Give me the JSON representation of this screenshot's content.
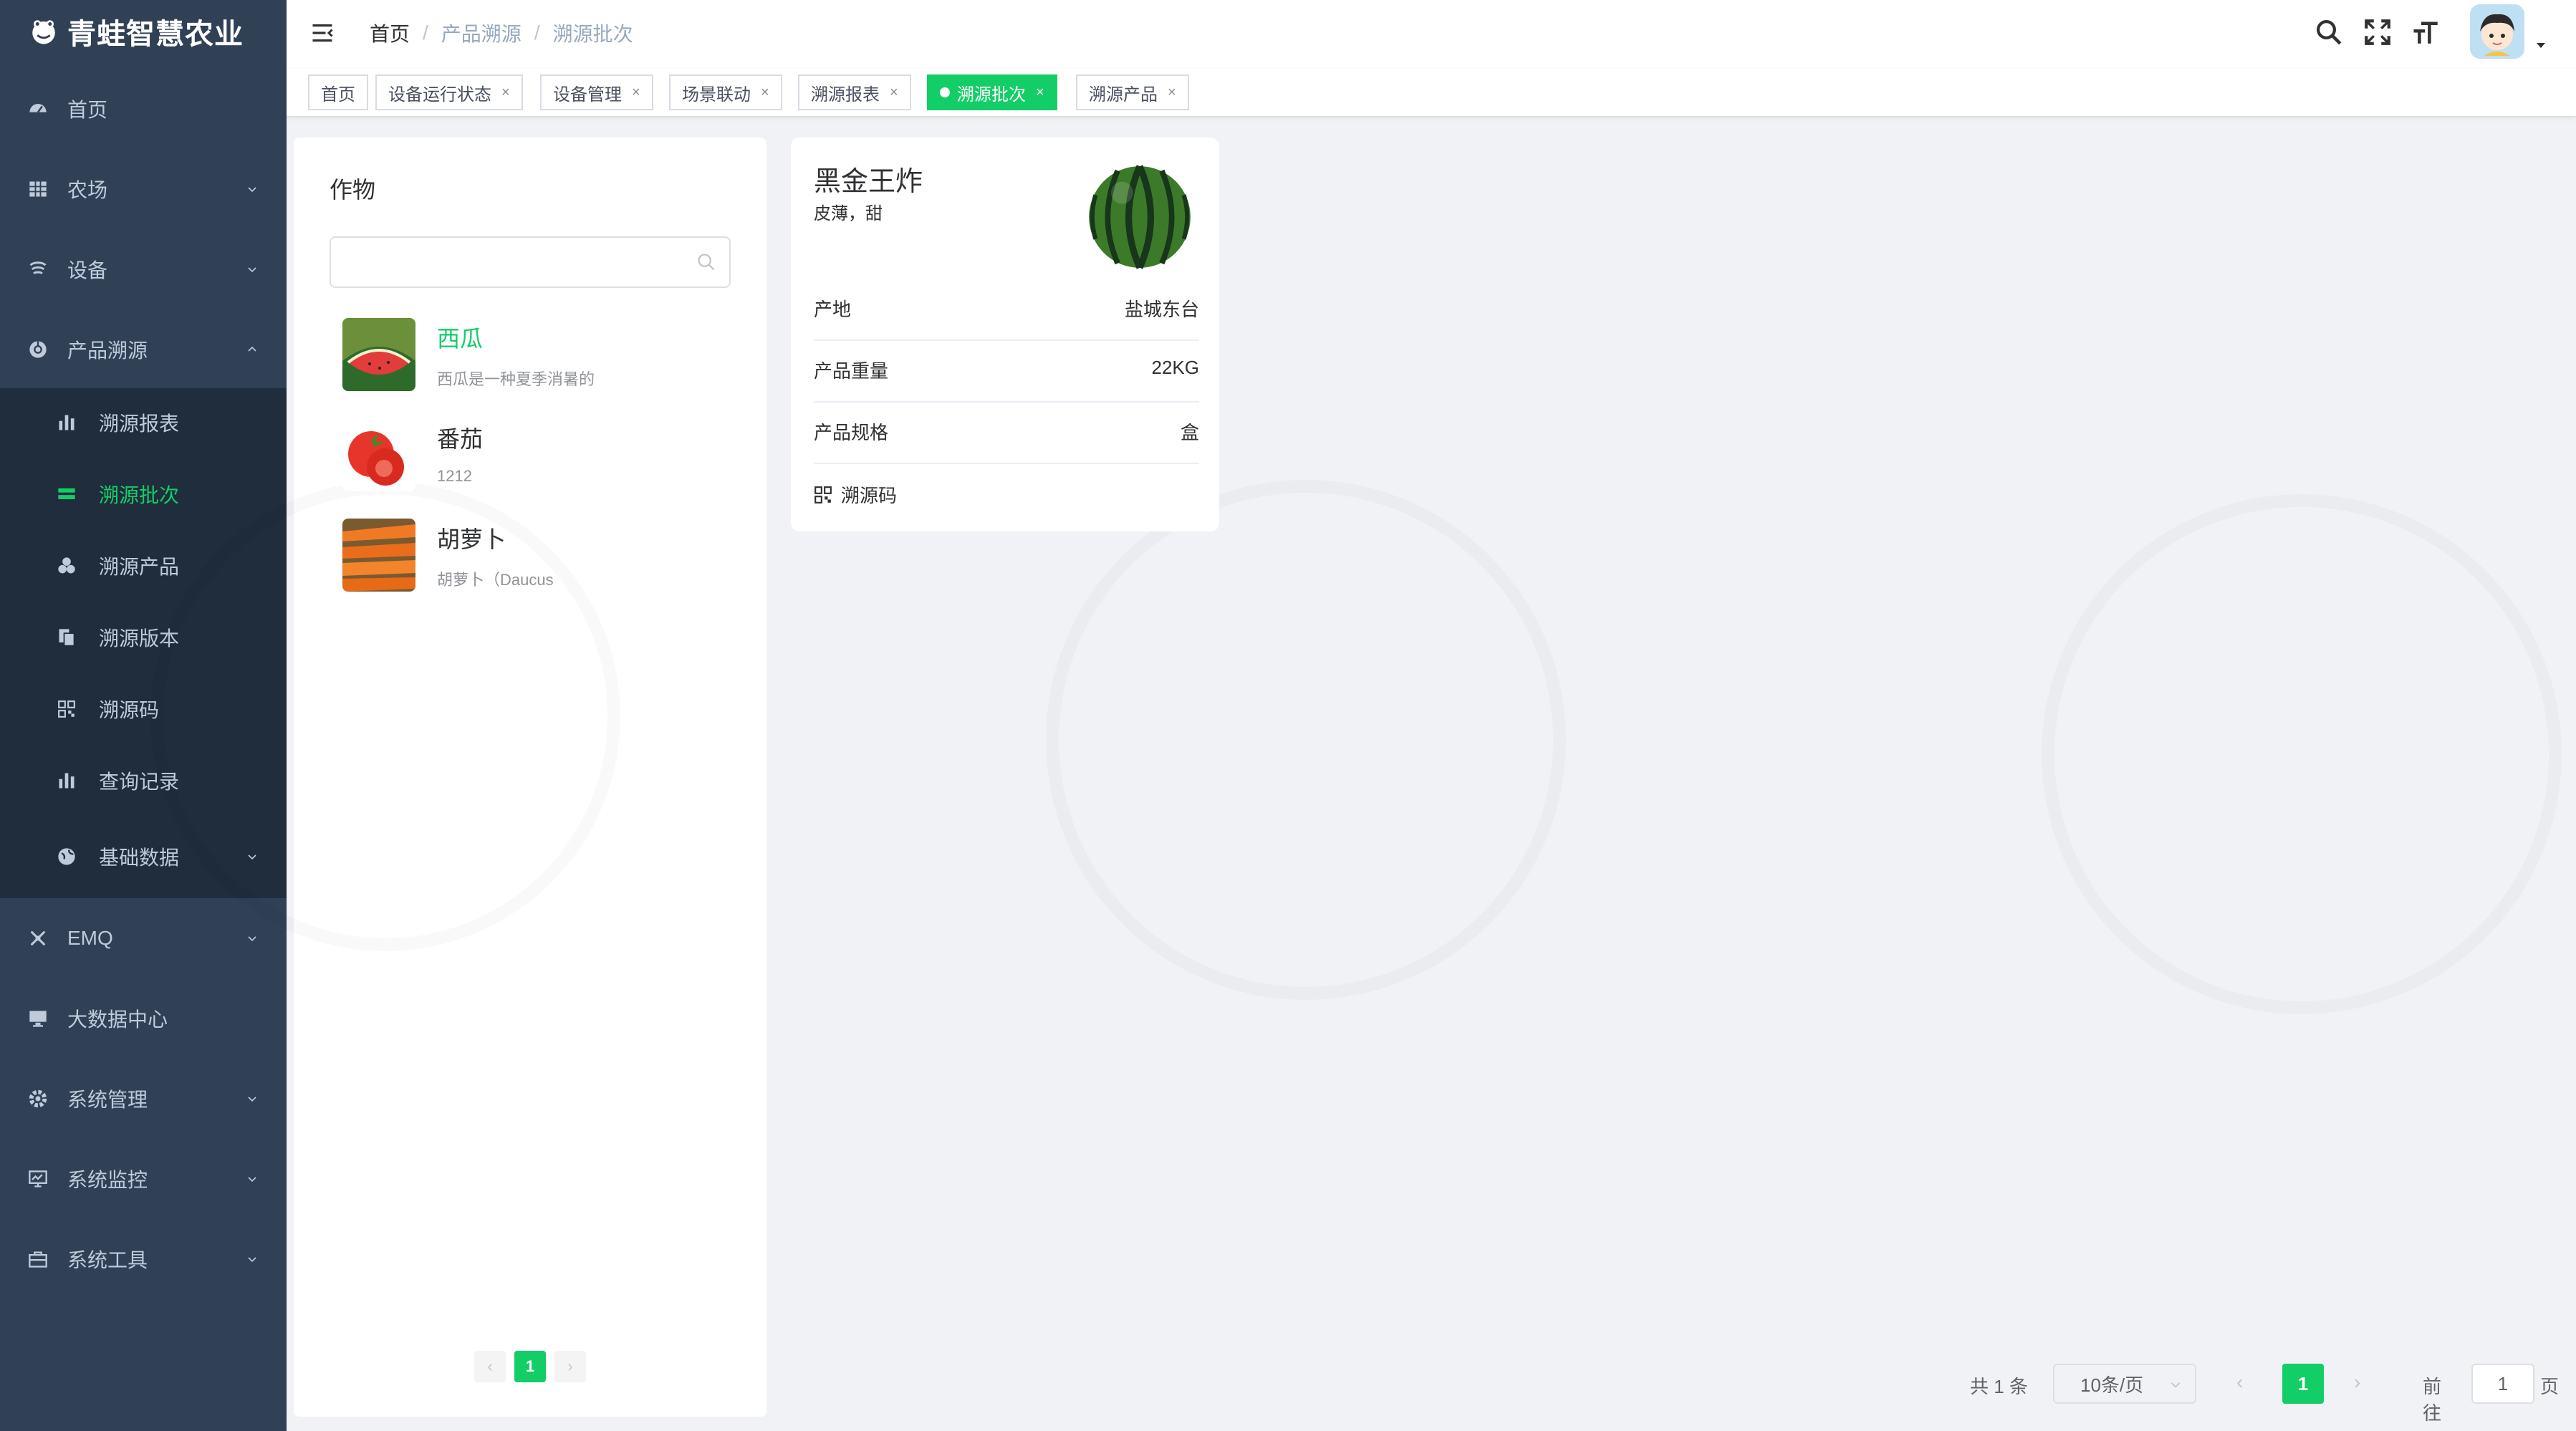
{
  "app": {
    "title": "青蛙智慧农业"
  },
  "sidebar": {
    "items": [
      {
        "label": "首页",
        "icon": "dashboard-icon"
      },
      {
        "label": "农场",
        "icon": "grid-icon",
        "expandable": true
      },
      {
        "label": "设备",
        "icon": "device-icon",
        "expandable": true
      },
      {
        "label": "产品溯源",
        "icon": "trace-icon",
        "expandable": true,
        "expanded": true
      },
      {
        "label": "EMQ",
        "icon": "emq-icon",
        "expandable": true
      },
      {
        "label": "大数据中心",
        "icon": "monitor-icon"
      },
      {
        "label": "系统管理",
        "icon": "gear-icon",
        "expandable": true
      },
      {
        "label": "系统监控",
        "icon": "monitor-chart-icon",
        "expandable": true
      },
      {
        "label": "系统工具",
        "icon": "toolbox-icon",
        "expandable": true
      }
    ],
    "subitems": [
      {
        "label": "溯源报表",
        "icon": "bar-chart-icon"
      },
      {
        "label": "溯源批次",
        "icon": "list-icon",
        "active": true
      },
      {
        "label": "溯源产品",
        "icon": "product-icon"
      },
      {
        "label": "溯源版本",
        "icon": "copy-icon"
      },
      {
        "label": "溯源码",
        "icon": "qrcode-icon"
      },
      {
        "label": "查询记录",
        "icon": "bar-chart-icon"
      },
      {
        "label": "基础数据",
        "icon": "globe-icon",
        "expandable": true
      }
    ]
  },
  "header": {
    "breadcrumb": [
      "首页",
      "产品溯源",
      "溯源批次"
    ]
  },
  "tags": [
    {
      "label": "首页",
      "closable": false
    },
    {
      "label": "设备运行状态",
      "closable": true
    },
    {
      "label": "设备管理",
      "closable": true
    },
    {
      "label": "场景联动",
      "closable": true
    },
    {
      "label": "溯源报表",
      "closable": true
    },
    {
      "label": "溯源批次",
      "closable": true,
      "active": true
    },
    {
      "label": "溯源产品",
      "closable": true
    }
  ],
  "close_glyph": "×",
  "crops": {
    "title": "作物",
    "search_placeholder": "",
    "items": [
      {
        "name": "西瓜",
        "desc": "西瓜是一种夏季消暑的",
        "active": true
      },
      {
        "name": "番茄",
        "desc": "1212"
      },
      {
        "name": "胡萝卜",
        "desc": "胡萝卜（Daucus"
      }
    ],
    "pager": {
      "prev": "‹",
      "current": "1",
      "next": "›"
    }
  },
  "detail": {
    "name": "黑金王炸",
    "subtitle": "皮薄，甜",
    "rows": [
      {
        "label": "产地",
        "value": "盐城东台"
      },
      {
        "label": "产品重量",
        "value": "22KG"
      },
      {
        "label": "产品规格",
        "value": "盒"
      }
    ],
    "trace_code_label": "溯源码"
  },
  "pagination": {
    "total": "共 1 条",
    "page_size": "10条/页",
    "prev": "‹",
    "current": "1",
    "next": "›",
    "goto_label": "前往",
    "goto_value": "1",
    "goto_unit": "页"
  },
  "colors": {
    "accent": "#13ce66",
    "sidebar_bg": "#304156",
    "submenu_bg": "#1f2d3d",
    "sidebar_text": "#bfcbd9"
  }
}
